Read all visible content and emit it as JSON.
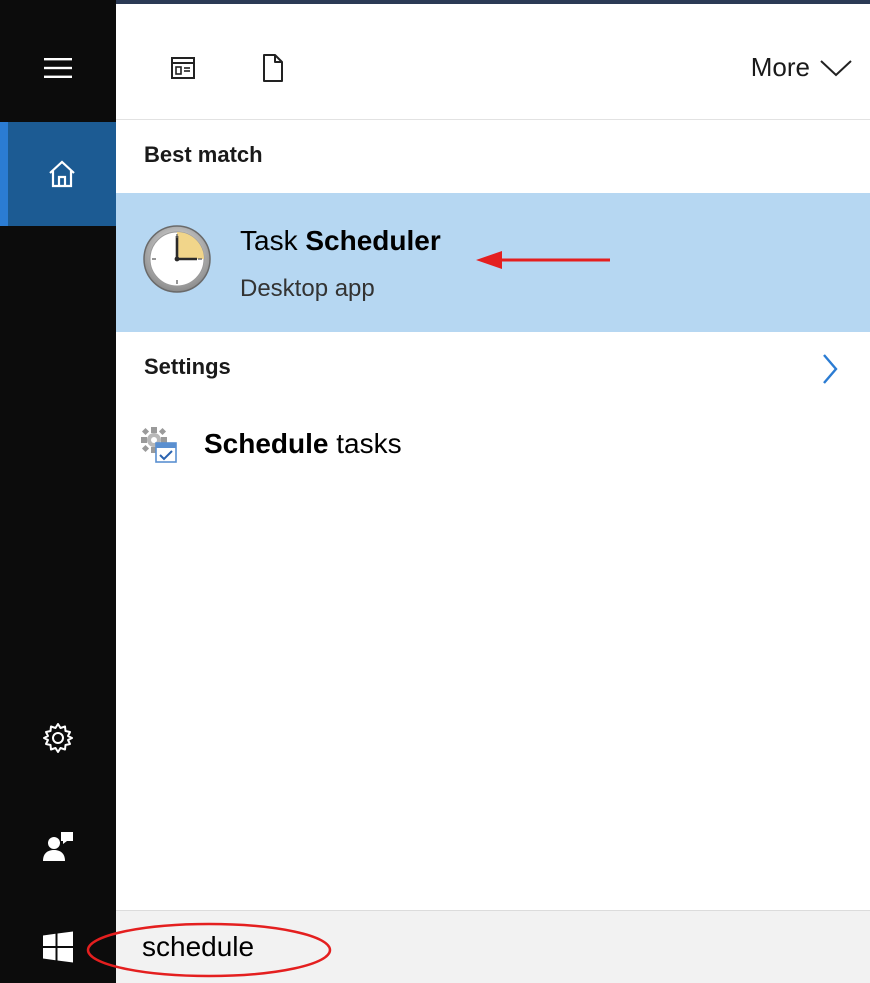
{
  "rail": {
    "menu_icon": "hamburger-menu-icon",
    "home_icon": "home-icon",
    "settings_icon": "gear-icon",
    "feedback_icon": "feedback-icon",
    "start_icon": "windows-logo-icon",
    "accent_color": "#1c5b93"
  },
  "toolbar": {
    "apps_icon": "apps-filter-icon",
    "documents_icon": "document-icon",
    "more_label": "More",
    "more_icon": "chevron-down-icon"
  },
  "best_match": {
    "header": "Best match",
    "item": {
      "title_prefix": "Task ",
      "title_bold": "Scheduler",
      "subtitle": "Desktop app",
      "icon": "clock-icon",
      "highlight_color": "#b6d7f2"
    }
  },
  "settings": {
    "header": "Settings",
    "chevron_icon": "chevron-right-icon",
    "items": [
      {
        "title_bold": "Schedule",
        "title_rest": " tasks",
        "icon": "schedule-tasks-icon"
      }
    ]
  },
  "search": {
    "value": "schedule"
  },
  "annotations": {
    "arrow_color": "#e41f1f",
    "ellipse_color": "#e41f1f"
  }
}
